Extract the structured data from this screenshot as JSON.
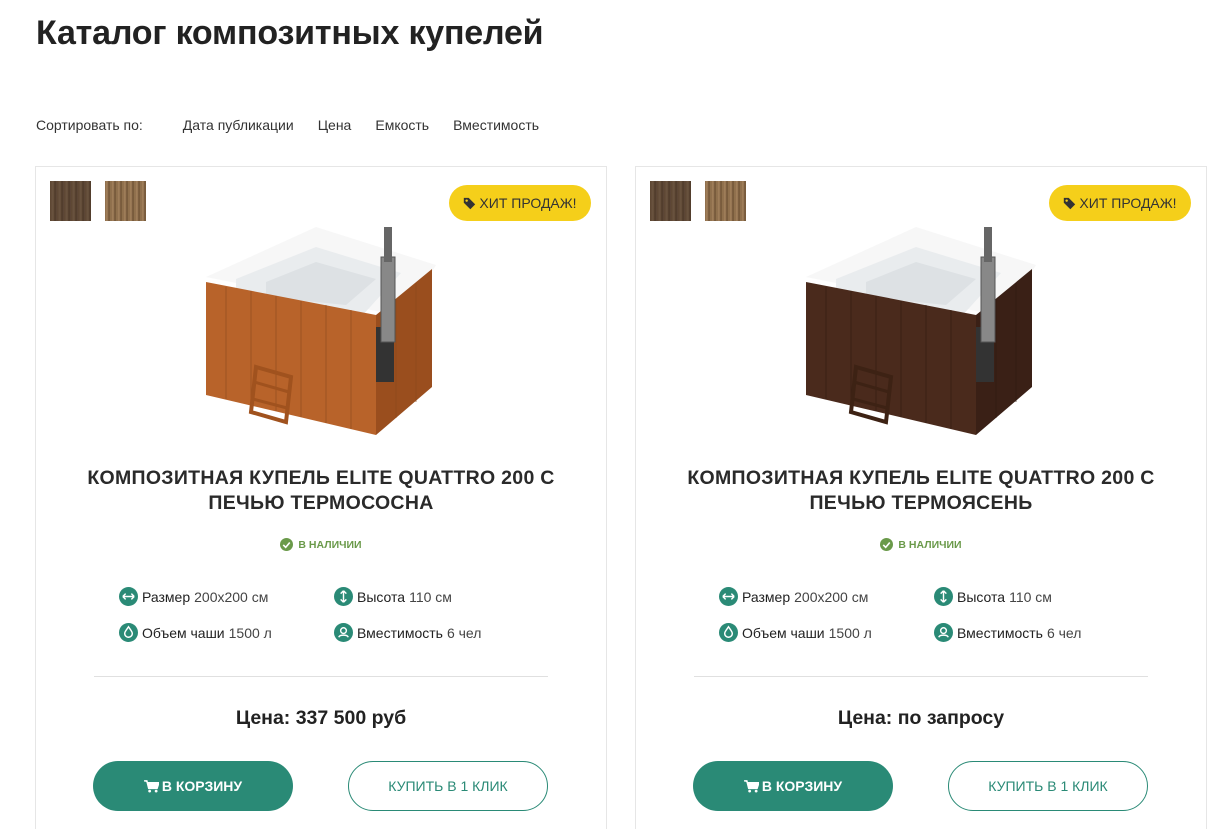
{
  "page": {
    "title": "Каталог композитных купелей"
  },
  "sort": {
    "label": "Сортировать по:",
    "options": [
      "Дата публикации",
      "Цена",
      "Емкость",
      "Вместимость"
    ]
  },
  "products": [
    {
      "title": "КОМПОЗИТНАЯ КУПЕЛЬ ELITE QUATTRO 200 С ПЕЧЬЮ ТЕРМОСОСНА",
      "badge": "ХИТ ПРОДАЖ!",
      "stock": "В НАЛИЧИИ",
      "size_label": "Размер",
      "size_value": "200х200 см",
      "height_label": "Высота",
      "height_value": "110 см",
      "volume_label": "Объем чаши",
      "volume_value": "1500 л",
      "capacity_label": "Вместимость",
      "capacity_value": "6 чел",
      "price": "Цена: 337 500 руб",
      "cart_label": "В КОРЗИНУ",
      "oneclick_label": "КУПИТЬ В 1 КЛИК",
      "wood_color": "#b8632a"
    },
    {
      "title": "КОМПОЗИТНАЯ КУПЕЛЬ ELITE QUATTRO 200 С ПЕЧЬЮ ТЕРМОЯСЕНЬ",
      "badge": "ХИТ ПРОДАЖ!",
      "stock": "В НАЛИЧИИ",
      "size_label": "Размер",
      "size_value": "200х200 см",
      "height_label": "Высота",
      "height_value": "110 см",
      "volume_label": "Объем чаши",
      "volume_value": "1500 л",
      "capacity_label": "Вместимость",
      "capacity_value": "6 чел",
      "price": "Цена: по запросу",
      "cart_label": "В КОРЗИНУ",
      "oneclick_label": "КУПИТЬ В 1 КЛИК",
      "wood_color": "#4a2a1c"
    }
  ],
  "colors": {
    "accent": "#2a8a76",
    "badge": "#f5cf1a",
    "stock": "#6a9a4a"
  }
}
